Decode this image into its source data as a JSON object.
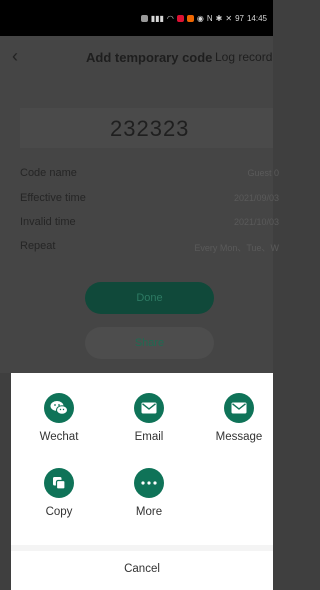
{
  "status_bar": {
    "time": "14:45",
    "battery": "97"
  },
  "nav": {
    "title": "Add temporary code",
    "right_link": "Log record"
  },
  "code": {
    "value": "232323"
  },
  "details": [
    {
      "label": "Code name",
      "value": "Guest 0"
    },
    {
      "label": "Effective time",
      "value": "2021/09/03"
    },
    {
      "label": "Invalid time",
      "value": "2021/10/03"
    },
    {
      "label": "Repeat",
      "value": "Every Mon、Tue、W"
    }
  ],
  "buttons": {
    "done": "Done",
    "share": "Share"
  },
  "share_sheet": {
    "items": [
      {
        "label": "Wechat",
        "icon": "wechat-icon"
      },
      {
        "label": "Email",
        "icon": "email-icon"
      },
      {
        "label": "Message",
        "icon": "message-icon"
      },
      {
        "label": "Copy",
        "icon": "copy-icon"
      },
      {
        "label": "More",
        "icon": "more-icon"
      }
    ],
    "cancel": "Cancel",
    "accent_color": "#0f7358"
  }
}
